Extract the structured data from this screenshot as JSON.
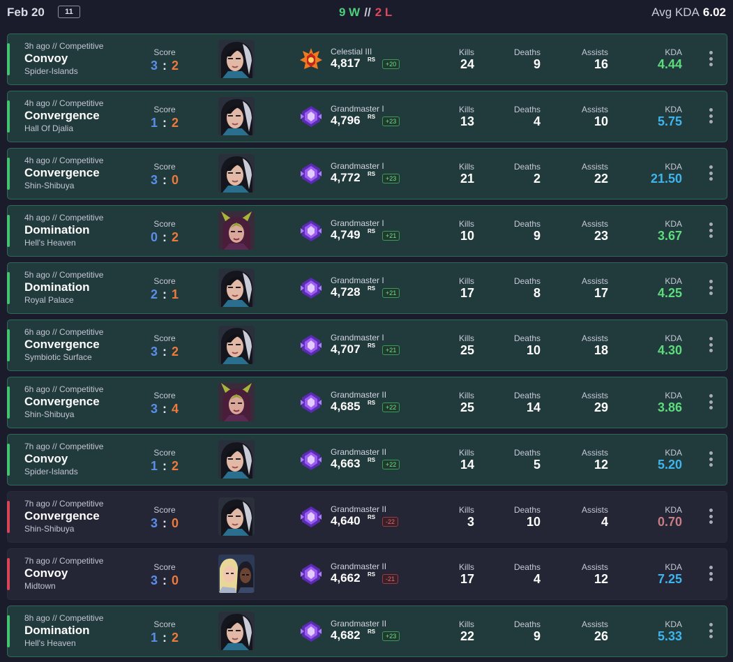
{
  "header": {
    "date": "Feb 20",
    "match_count": "11",
    "wins": "9 W",
    "separator": "//",
    "losses": "2 L",
    "avg_kda_label": "Avg KDA",
    "avg_kda_value": "6.02"
  },
  "labels": {
    "score": "Score",
    "kills": "Kills",
    "deaths": "Deaths",
    "assists": "Assists",
    "kda": "KDA",
    "rs": "RS"
  },
  "colors": {
    "win": "#43c46f",
    "loss": "#d84556",
    "ally_score": "#5b8eea",
    "enemy_score": "#ee7a3c",
    "kda_green": "#5ddb7d",
    "kda_blue": "#3fb5ee",
    "kda_red": "#c97d84"
  },
  "matches": [
    {
      "result": "win",
      "meta": "3h ago  //  Competitive",
      "mode": "Convoy",
      "map": "Spider-Islands",
      "score_ally": "3",
      "score_enemy": "2",
      "hero_icon": "hero-portrait-dark-hair-icon",
      "rank_icon": "celestial-rank-icon",
      "rank": "Celestial III",
      "rating": "4,817",
      "delta": "+20",
      "kills": "24",
      "deaths": "9",
      "assists": "16",
      "kda": "4.44",
      "kda_color": "green"
    },
    {
      "result": "win",
      "meta": "4h ago  //  Competitive",
      "mode": "Convergence",
      "map": "Hall Of Djalia",
      "score_ally": "1",
      "score_enemy": "2",
      "hero_icon": "hero-portrait-dark-hair-icon",
      "rank_icon": "grandmaster-rank-icon",
      "rank": "Grandmaster I",
      "rating": "4,796",
      "delta": "+23",
      "kills": "13",
      "deaths": "4",
      "assists": "10",
      "kda": "5.75",
      "kda_color": "blue"
    },
    {
      "result": "win",
      "meta": "4h ago  //  Competitive",
      "mode": "Convergence",
      "map": "Shin-Shibuya",
      "score_ally": "3",
      "score_enemy": "0",
      "hero_icon": "hero-portrait-dark-hair-icon",
      "rank_icon": "grandmaster-rank-icon",
      "rank": "Grandmaster I",
      "rating": "4,772",
      "delta": "+23",
      "kills": "21",
      "deaths": "2",
      "assists": "22",
      "kda": "21.50",
      "kda_color": "blue"
    },
    {
      "result": "win",
      "meta": "4h ago  //  Competitive",
      "mode": "Domination",
      "map": "Hell's Heaven",
      "score_ally": "0",
      "score_enemy": "2",
      "hero_icon": "hero-portrait-horned-icon",
      "rank_icon": "grandmaster-rank-icon",
      "rank": "Grandmaster I",
      "rating": "4,749",
      "delta": "+21",
      "kills": "10",
      "deaths": "9",
      "assists": "23",
      "kda": "3.67",
      "kda_color": "green"
    },
    {
      "result": "win",
      "meta": "5h ago  //  Competitive",
      "mode": "Domination",
      "map": "Royal Palace",
      "score_ally": "2",
      "score_enemy": "1",
      "hero_icon": "hero-portrait-dark-hair-icon",
      "rank_icon": "grandmaster-rank-icon",
      "rank": "Grandmaster I",
      "rating": "4,728",
      "delta": "+21",
      "kills": "17",
      "deaths": "8",
      "assists": "17",
      "kda": "4.25",
      "kda_color": "green"
    },
    {
      "result": "win",
      "meta": "6h ago  //  Competitive",
      "mode": "Convergence",
      "map": "Symbiotic Surface",
      "score_ally": "3",
      "score_enemy": "2",
      "hero_icon": "hero-portrait-dark-hair-icon",
      "rank_icon": "grandmaster-rank-icon",
      "rank": "Grandmaster I",
      "rating": "4,707",
      "delta": "+21",
      "kills": "25",
      "deaths": "10",
      "assists": "18",
      "kda": "4.30",
      "kda_color": "green"
    },
    {
      "result": "win",
      "meta": "6h ago  //  Competitive",
      "mode": "Convergence",
      "map": "Shin-Shibuya",
      "score_ally": "3",
      "score_enemy": "4",
      "hero_icon": "hero-portrait-horned-icon",
      "rank_icon": "grandmaster-rank-icon",
      "rank": "Grandmaster II",
      "rating": "4,685",
      "delta": "+22",
      "kills": "25",
      "deaths": "14",
      "assists": "29",
      "kda": "3.86",
      "kda_color": "green"
    },
    {
      "result": "win",
      "meta": "7h ago  //  Competitive",
      "mode": "Convoy",
      "map": "Spider-Islands",
      "score_ally": "1",
      "score_enemy": "2",
      "hero_icon": "hero-portrait-dark-hair-icon",
      "rank_icon": "grandmaster-rank-icon",
      "rank": "Grandmaster II",
      "rating": "4,663",
      "delta": "+22",
      "kills": "14",
      "deaths": "5",
      "assists": "12",
      "kda": "5.20",
      "kda_color": "blue"
    },
    {
      "result": "loss",
      "meta": "7h ago  //  Competitive",
      "mode": "Convergence",
      "map": "Shin-Shibuya",
      "score_ally": "3",
      "score_enemy": "0",
      "hero_icon": "hero-portrait-dark-hair-icon",
      "rank_icon": "grandmaster-rank-icon",
      "rank": "Grandmaster II",
      "rating": "4,640",
      "delta": "-22",
      "kills": "3",
      "deaths": "10",
      "assists": "4",
      "kda": "0.70",
      "kda_color": "red"
    },
    {
      "result": "loss",
      "meta": "7h ago  //  Competitive",
      "mode": "Convoy",
      "map": "Midtown",
      "score_ally": "3",
      "score_enemy": "0",
      "hero_icon": "hero-portrait-duo-icon",
      "rank_icon": "grandmaster-rank-icon",
      "rank": "Grandmaster II",
      "rating": "4,662",
      "delta": "-21",
      "kills": "17",
      "deaths": "4",
      "assists": "12",
      "kda": "7.25",
      "kda_color": "blue"
    },
    {
      "result": "win",
      "meta": "8h ago  //  Competitive",
      "mode": "Domination",
      "map": "Hell's Heaven",
      "score_ally": "1",
      "score_enemy": "2",
      "hero_icon": "hero-portrait-dark-hair-icon",
      "rank_icon": "grandmaster-rank-icon",
      "rank": "Grandmaster II",
      "rating": "4,682",
      "delta": "+23",
      "kills": "22",
      "deaths": "9",
      "assists": "26",
      "kda": "5.33",
      "kda_color": "blue"
    }
  ]
}
